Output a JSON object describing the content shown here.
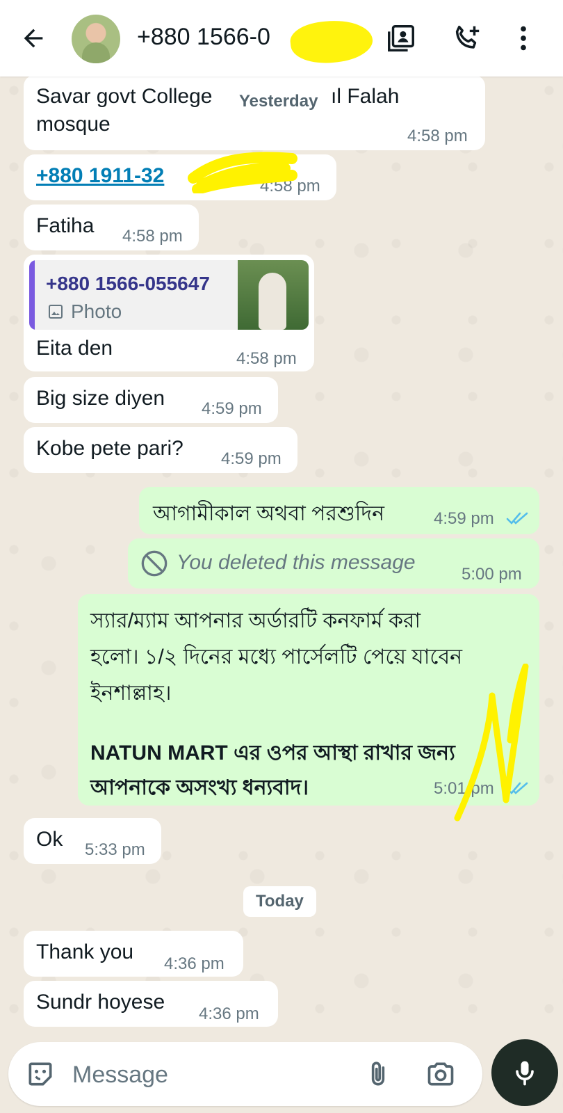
{
  "header": {
    "contact_name": "+880 1566-0",
    "icons": [
      "back-arrow-icon",
      "avatar",
      "contact-card-icon",
      "add-call-icon",
      "more-vert-icon"
    ]
  },
  "day_labels": {
    "yesterday": "Yesterday",
    "today": "Today"
  },
  "messages": [
    {
      "dir": "in",
      "text_line1": "Savar govt College",
      "text_line1b": "ıl Falah",
      "text_line2": "mosque",
      "time": "4:58 pm"
    },
    {
      "dir": "in",
      "link": "+880 1911-32",
      "time": "4:58 pm"
    },
    {
      "dir": "in",
      "text": "Fatiha",
      "time": "4:58 pm"
    },
    {
      "dir": "in",
      "quote_name": "+880 1566-055647",
      "quote_type": "Photo",
      "text": "Eita den",
      "time": "4:58 pm"
    },
    {
      "dir": "in",
      "text": "Big size diyen",
      "time": "4:59 pm"
    },
    {
      "dir": "in",
      "text": "Kobe pete pari?",
      "time": "4:59 pm"
    },
    {
      "dir": "out",
      "text": "আগামীকাল অথবা পরশুদিন",
      "time": "4:59 pm"
    },
    {
      "dir": "out",
      "text": "You deleted this message",
      "time": "5:00 pm"
    },
    {
      "dir": "out",
      "line1": "স্যার/ম্যাম আপনার অর্ডারটি কনফার্ম করা",
      "line2": "হলো। ১/২ দিনের মধ্যে পার্সেলটি পেয়ে যাবেন",
      "line3": "ইনশাল্লাহ।",
      "line4": "NATUN MART এর ওপর আস্থা রাখার জন্য",
      "line5": "আপনাকে অসংখ্য ধন্যবাদ।",
      "time": "5:01 pm"
    },
    {
      "dir": "in",
      "text": "Ok",
      "time": "5:33 pm"
    },
    {
      "dir": "in",
      "text": "Thank you",
      "time": "4:36 pm"
    },
    {
      "dir": "in",
      "text": "Sundr hoyese",
      "time": "4:36 pm"
    }
  ],
  "composer": {
    "placeholder": "Message",
    "icons": [
      "sticker-icon",
      "attach-icon",
      "camera-icon",
      "mic-icon"
    ]
  },
  "colors": {
    "incoming": "#ffffff",
    "outgoing": "#d9fdd3",
    "read_tick": "#53bdeb",
    "link": "#027eb5"
  }
}
